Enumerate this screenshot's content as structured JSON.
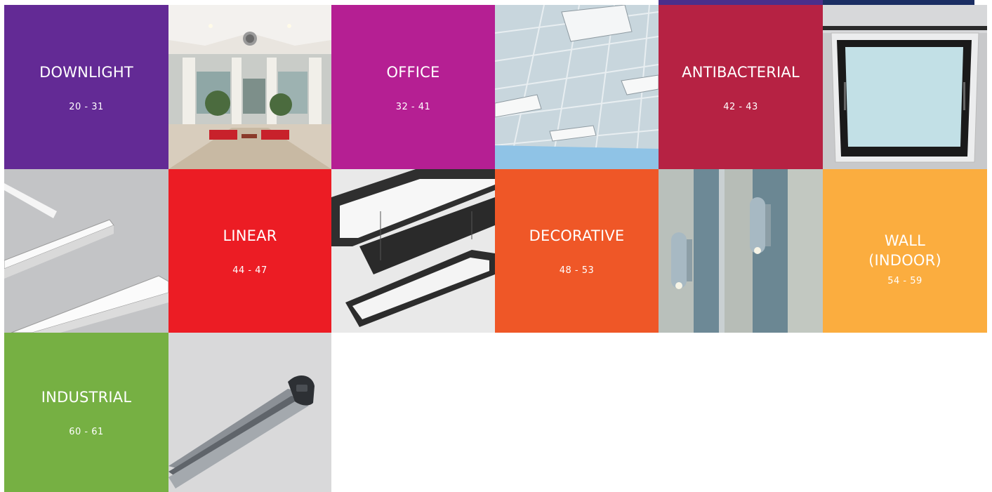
{
  "categories": [
    {
      "label": "DOWNLIGHT",
      "pages": "20 - 31",
      "color": "#632a95"
    },
    {
      "label": "OFFICE",
      "pages": "32 - 41",
      "color": "#b51f93"
    },
    {
      "label": "ANTIBACTERIAL",
      "pages": "42 - 43",
      "color": "#b62243"
    },
    {
      "label": "LINEAR",
      "pages": "44 - 47",
      "color": "#ec1c24"
    },
    {
      "label": "DECORATIVE",
      "pages": "48 - 53",
      "color": "#ef5727"
    },
    {
      "label_line1": "WALL",
      "label_line2": "(INDOOR)",
      "pages": "54 - 59",
      "color": "#fbad3f"
    },
    {
      "label": "INDUSTRIAL",
      "pages": "60 - 61",
      "color": "#76b043"
    }
  ],
  "photos": [
    {
      "icon": "mall-atrium-photo"
    },
    {
      "icon": "ceiling-grid-photo"
    },
    {
      "icon": "square-panel-light-photo"
    },
    {
      "icon": "recessed-linear-light-photo"
    },
    {
      "icon": "suspended-frame-light-photo"
    },
    {
      "icon": "wall-uplight-photo"
    },
    {
      "icon": "industrial-linear-fixture-photo"
    }
  ]
}
